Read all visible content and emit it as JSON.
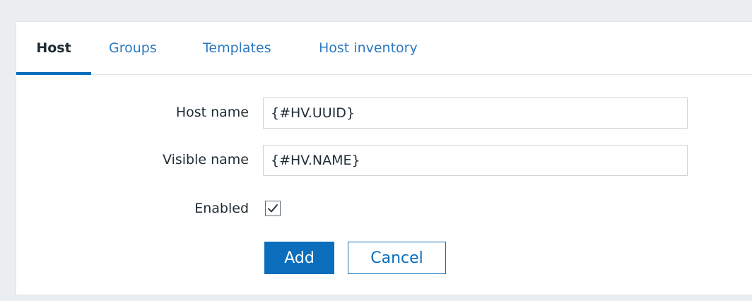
{
  "tabs": {
    "host": "Host",
    "groups": "Groups",
    "templates": "Templates",
    "inventory": "Host inventory",
    "active": "Host"
  },
  "form": {
    "host_name_label": "Host name",
    "host_name_value": "{#HV.UUID}",
    "visible_name_label": "Visible name",
    "visible_name_value": "{#HV.NAME}",
    "enabled_label": "Enabled",
    "enabled_checked": true
  },
  "buttons": {
    "add": "Add",
    "cancel": "Cancel"
  },
  "colors": {
    "accent": "#0a6ebd",
    "link": "#2c7ac0",
    "text": "#1f2c33",
    "background": "#ebeef0"
  }
}
